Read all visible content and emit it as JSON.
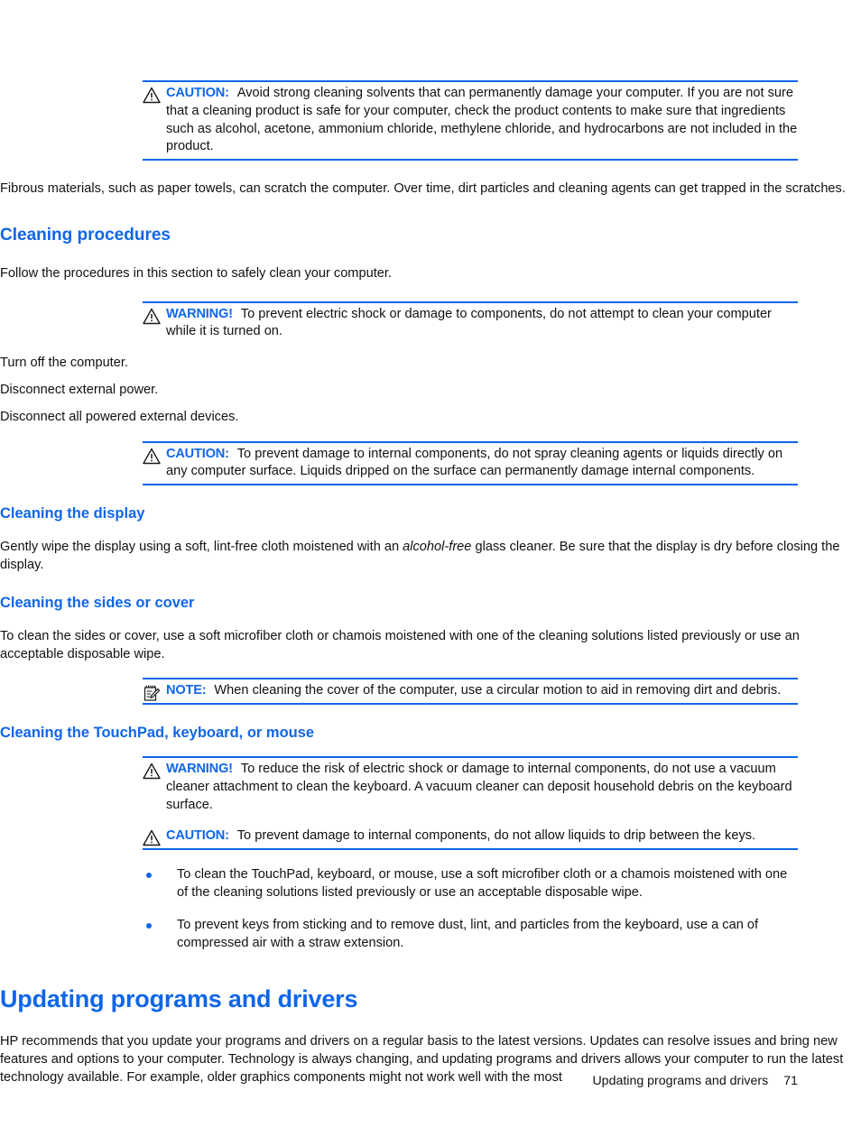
{
  "page": {
    "number": "71",
    "footer_title": "Updating programs and drivers"
  },
  "blocks": {
    "caution_solvents": {
      "label": "CAUTION:",
      "text": "Avoid strong cleaning solvents that can permanently damage your computer. If you are not sure that a cleaning product is safe for your computer, check the product contents to make sure that ingredients such as alcohol, acetone, ammonium chloride, methylene chloride, and hydrocarbons are not included in the product.",
      "icon": "warning-triangle-icon"
    },
    "fibrous_paragraph": {
      "text": "Fibrous materials, such as paper towels, can scratch the computer. Over time, dirt particles and cleaning agents can get trapped in the scratches."
    },
    "cleaning_procedures_heading": {
      "text": "Cleaning procedures"
    },
    "follow_procedures_paragraph": {
      "text": "Follow the procedures in this section to safely clean your computer."
    },
    "warning_electric_shock": {
      "label": "WARNING!",
      "text": "To prevent electric shock or damage to components, do not attempt to clean your computer while it is turned on.",
      "icon": "warning-triangle-icon"
    },
    "step_turn_off": {
      "text": "Turn off the computer."
    },
    "step_disconnect_power": {
      "text": "Disconnect external power."
    },
    "step_disconnect_devices": {
      "text": "Disconnect all powered external devices."
    },
    "caution_spray": {
      "label": "CAUTION:",
      "text": "To prevent damage to internal components, do not spray cleaning agents or liquids directly on any computer surface. Liquids dripped on the surface can permanently damage internal components.",
      "icon": "warning-triangle-icon"
    },
    "cleaning_display_heading": {
      "text": "Cleaning the display"
    },
    "cleaning_display_paragraph": {
      "before": "Gently wipe the display using a soft, lint-free cloth moistened with an ",
      "italic": "alcohol-free",
      "after": " glass cleaner. Be sure that the display is dry before closing the display."
    },
    "cleaning_sides_heading": {
      "text": "Cleaning the sides or cover"
    },
    "cleaning_sides_paragraph": {
      "text": "To clean the sides or cover, use a soft microfiber cloth or chamois moistened with one of the cleaning solutions listed previously or use an acceptable disposable wipe."
    },
    "note_circular_motion": {
      "label": "NOTE:",
      "text": "When cleaning the cover of the computer, use a circular motion to aid in removing dirt and debris.",
      "icon": "note-pad-icon"
    },
    "cleaning_touchpad_heading": {
      "text": "Cleaning the TouchPad, keyboard, or mouse"
    },
    "warning_vacuum": {
      "label": "WARNING!",
      "text": "To reduce the risk of electric shock or damage to internal components, do not use a vacuum cleaner attachment to clean the keyboard. A vacuum cleaner can deposit household debris on the keyboard surface.",
      "icon": "warning-triangle-icon"
    },
    "caution_liquids_keys": {
      "label": "CAUTION:",
      "text": "To prevent damage to internal components, do not allow liquids to drip between the keys.",
      "icon": "warning-triangle-icon"
    },
    "updating_heading": {
      "text": "Updating programs and drivers"
    },
    "updating_paragraph": {
      "text": "HP recommends that you update your programs and drivers on a regular basis to the latest versions. Updates can resolve issues and bring new features and options to your computer. Technology is always changing, and updating programs and drivers allows your computer to run the latest technology available. For example, older graphics components might not work well with the most"
    }
  },
  "bullets": [
    {
      "text": "To clean the TouchPad, keyboard, or mouse, use a soft microfiber cloth or a chamois moistened with one of the cleaning solutions listed previously or use an acceptable disposable wipe."
    },
    {
      "text": "To prevent keys from sticking and to remove dust, lint, and particles from the keyboard, use a can of compressed air with a straw extension."
    }
  ],
  "colors": {
    "accent_blue": "#1066e8",
    "text_black": "#111111"
  }
}
